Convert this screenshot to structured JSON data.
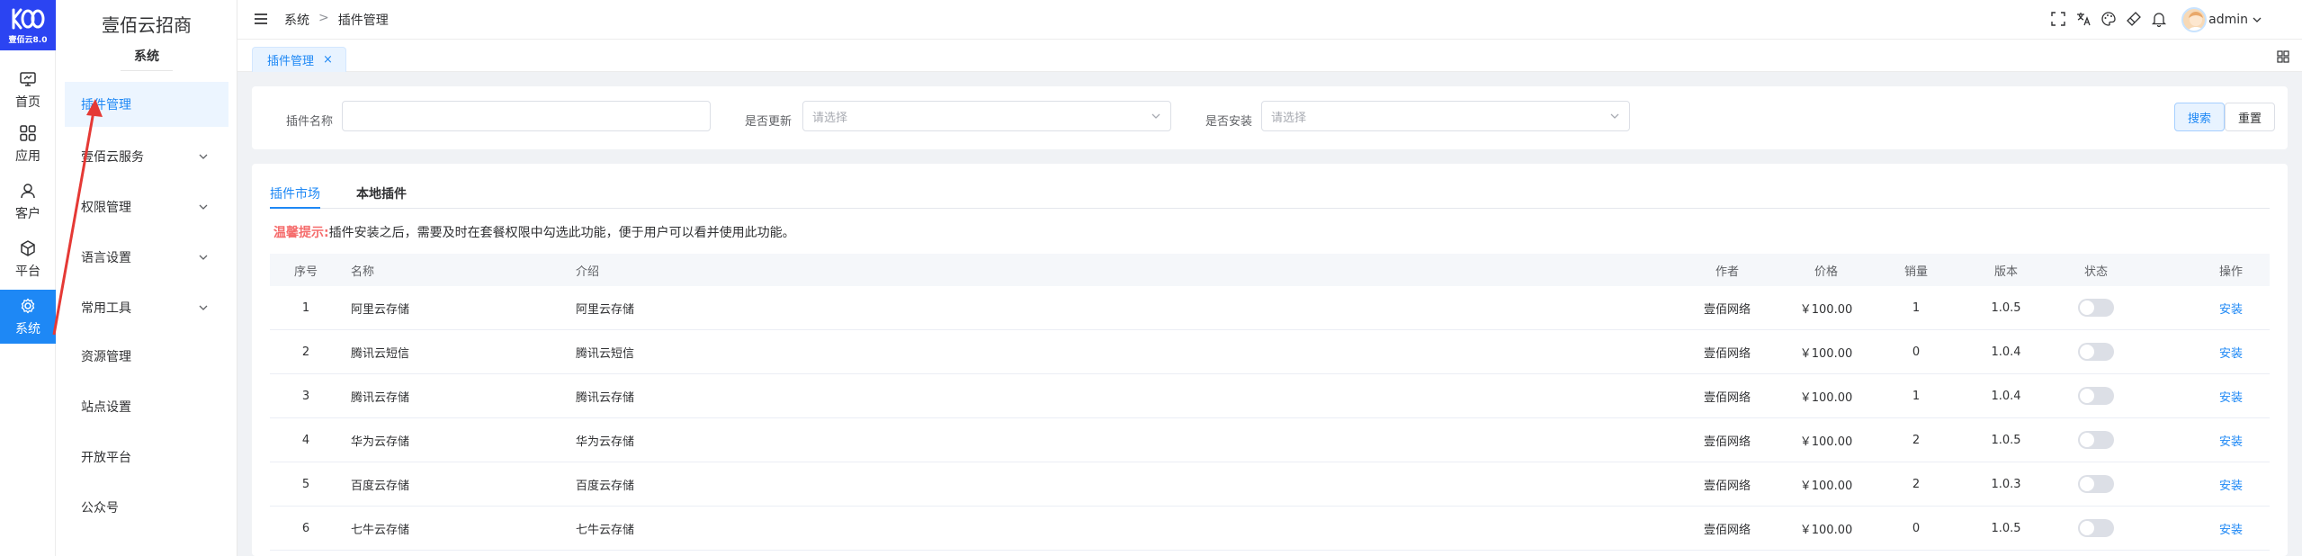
{
  "rail": {
    "logo_version": "壹佰云8.0",
    "items": [
      {
        "label": "首页",
        "icon": "monitor-icon"
      },
      {
        "label": "应用",
        "icon": "apps-icon"
      },
      {
        "label": "客户",
        "icon": "user-icon"
      },
      {
        "label": "平台",
        "icon": "cube-icon"
      },
      {
        "label": "系统",
        "icon": "gear-icon",
        "active": true
      }
    ]
  },
  "subside": {
    "title": "壹佰云招商",
    "section": "系统",
    "items": [
      {
        "label": "插件管理",
        "active": true,
        "expandable": false
      },
      {
        "label": "壹佰云服务",
        "expandable": true
      },
      {
        "label": "权限管理",
        "expandable": true
      },
      {
        "label": "语言设置",
        "expandable": true
      },
      {
        "label": "常用工具",
        "expandable": true
      },
      {
        "label": "资源管理",
        "expandable": false
      },
      {
        "label": "站点设置",
        "expandable": false
      },
      {
        "label": "开放平台",
        "expandable": false
      },
      {
        "label": "公众号",
        "expandable": false
      }
    ]
  },
  "header": {
    "breadcrumb": [
      "系统",
      "插件管理"
    ],
    "breadcrumb_sep": ">",
    "username": "admin"
  },
  "tagsbar": {
    "active_tag": "插件管理",
    "close_glyph": "×"
  },
  "search": {
    "name_label": "插件名称",
    "name_value": "",
    "update_label": "是否更新",
    "update_placeholder": "请选择",
    "install_label": "是否安装",
    "install_placeholder": "请选择",
    "search_btn": "搜索",
    "reset_btn": "重置"
  },
  "tabs": {
    "market": "插件市场",
    "local": "本地插件"
  },
  "notice": {
    "prefix": "温馨提示:",
    "text": "插件安装之后，需要及时在套餐权限中勾选此功能，便于用户可以看并使用此功能。"
  },
  "table": {
    "headers": [
      "序号",
      "名称",
      "介绍",
      "作者",
      "价格",
      "销量",
      "版本",
      "状态",
      "操作"
    ],
    "rows": [
      {
        "no": "1",
        "name": "阿里云存储",
        "intro": "阿里云存储",
        "author": "壹佰网络",
        "price": "￥100.00",
        "sales": "1",
        "version": "1.0.5",
        "enabled": false,
        "op": "安装"
      },
      {
        "no": "2",
        "name": "腾讯云短信",
        "intro": "腾讯云短信",
        "author": "壹佰网络",
        "price": "￥100.00",
        "sales": "0",
        "version": "1.0.4",
        "enabled": false,
        "op": "安装"
      },
      {
        "no": "3",
        "name": "腾讯云存储",
        "intro": "腾讯云存储",
        "author": "壹佰网络",
        "price": "￥100.00",
        "sales": "1",
        "version": "1.0.4",
        "enabled": false,
        "op": "安装"
      },
      {
        "no": "4",
        "name": "华为云存储",
        "intro": "华为云存储",
        "author": "壹佰网络",
        "price": "￥100.00",
        "sales": "2",
        "version": "1.0.5",
        "enabled": false,
        "op": "安装"
      },
      {
        "no": "5",
        "name": "百度云存储",
        "intro": "百度云存储",
        "author": "壹佰网络",
        "price": "￥100.00",
        "sales": "2",
        "version": "1.0.3",
        "enabled": false,
        "op": "安装"
      },
      {
        "no": "6",
        "name": "七牛云存储",
        "intro": "七牛云存储",
        "author": "壹佰网络",
        "price": "￥100.00",
        "sales": "0",
        "version": "1.0.5",
        "enabled": false,
        "op": "安装"
      }
    ]
  },
  "colors": {
    "brand": "#2b44f2",
    "accent": "#1e88f5",
    "warn": "#f56c6c",
    "annotation": "#e53935"
  }
}
